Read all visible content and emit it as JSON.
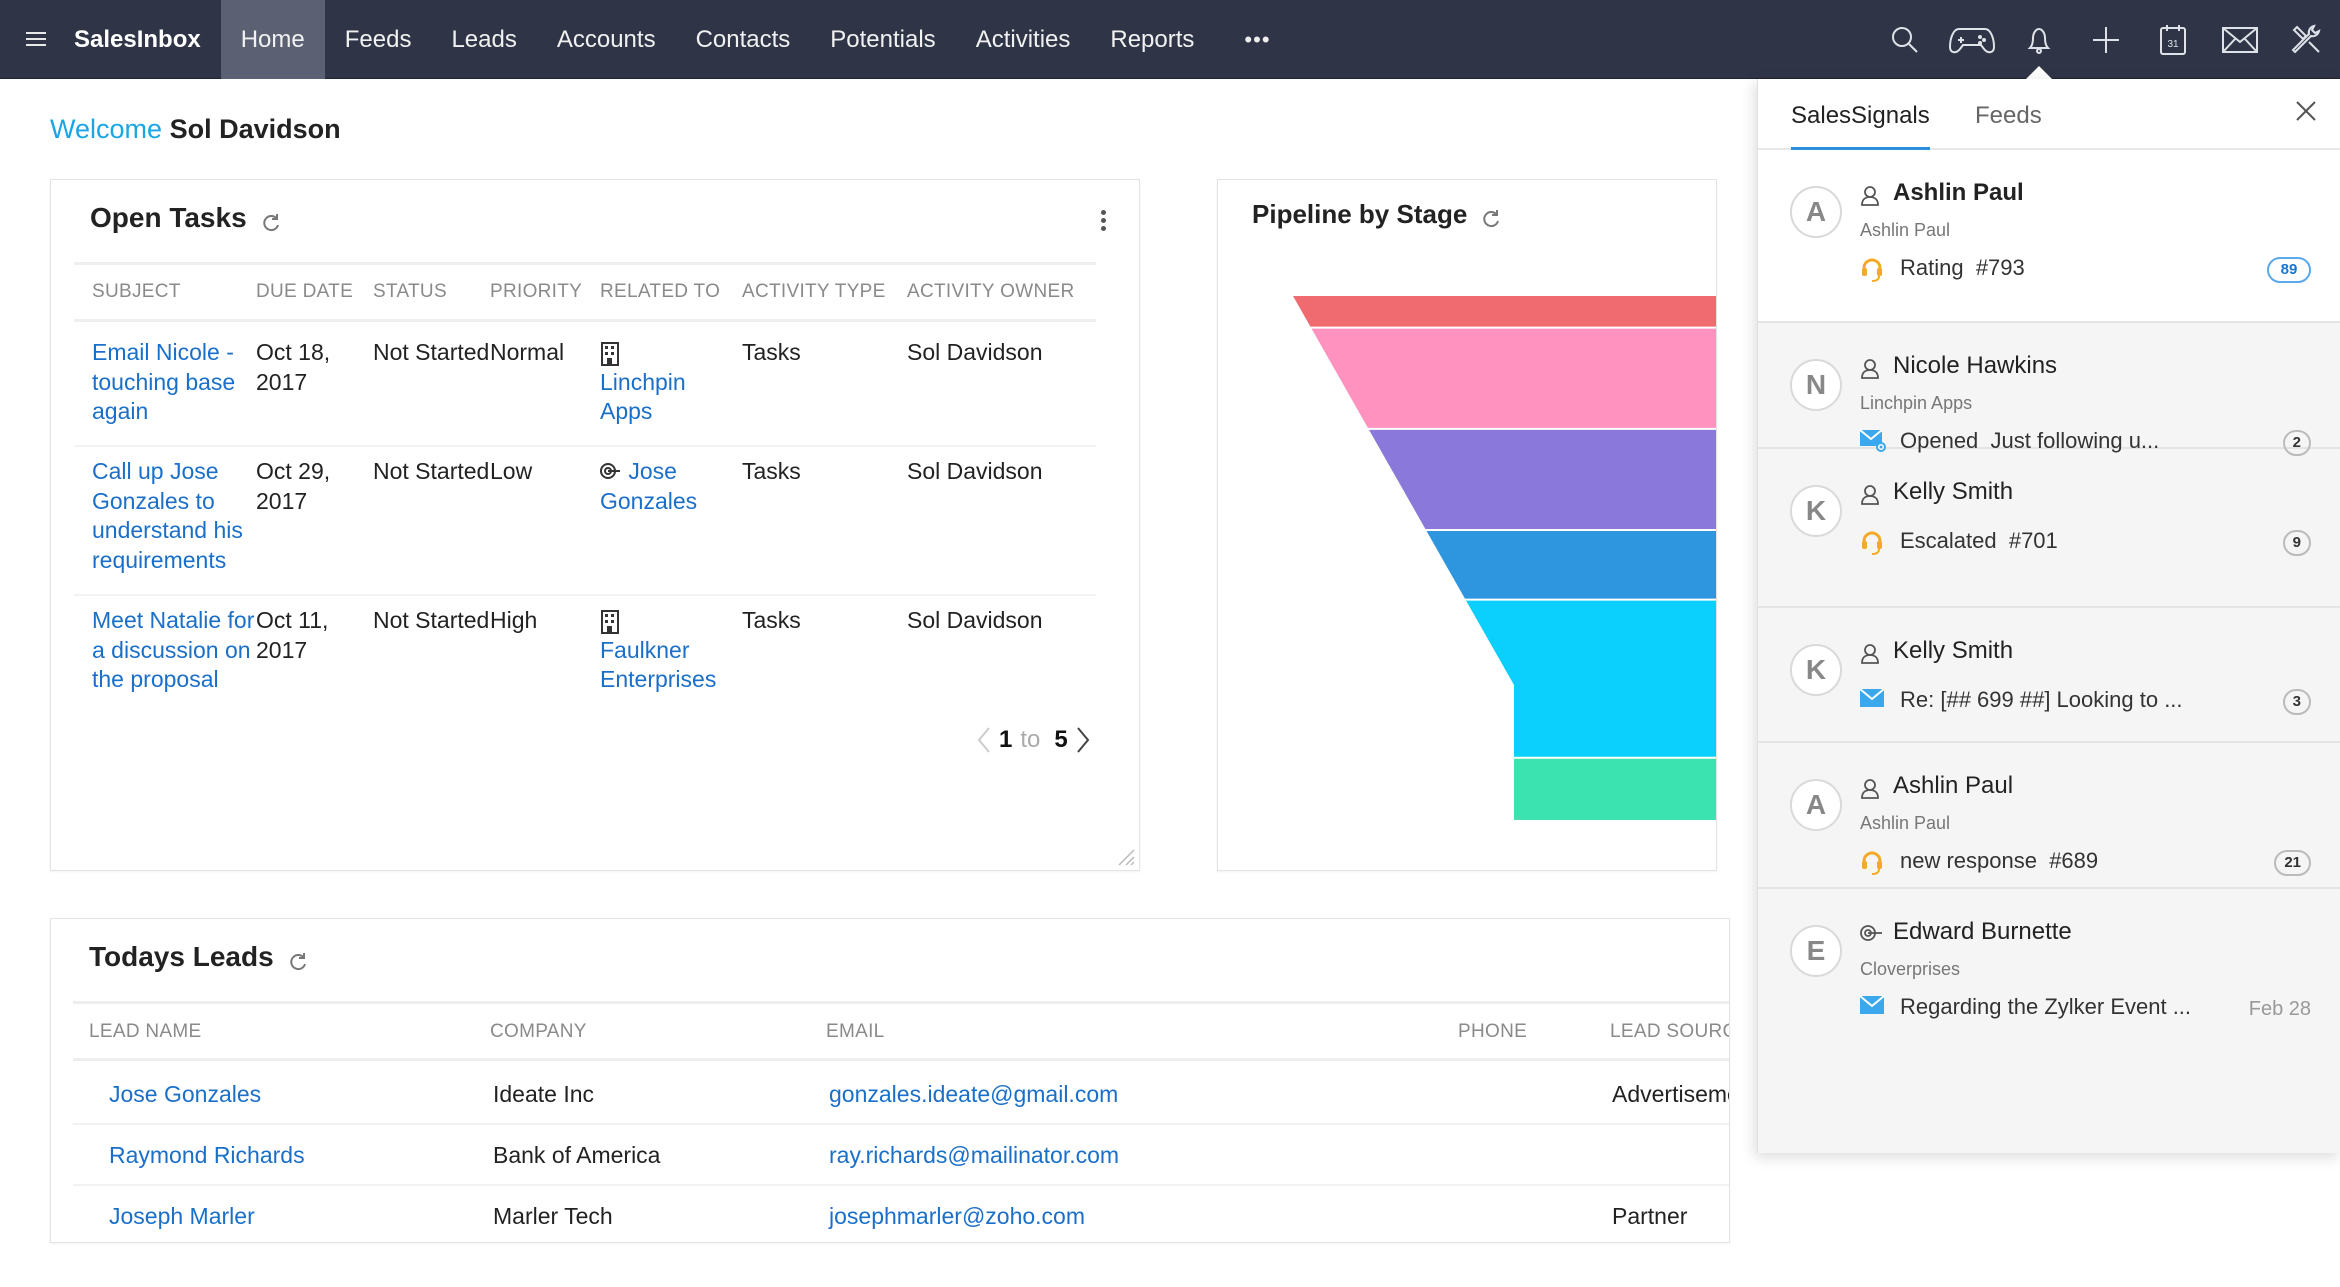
{
  "nav": {
    "brand": "SalesInbox",
    "tabs": [
      "Home",
      "Feeds",
      "Leads",
      "Accounts",
      "Contacts",
      "Potentials",
      "Activities",
      "Reports"
    ],
    "active_tab": "Home",
    "more": "•••",
    "icons": [
      "search-icon",
      "gamepad-icon",
      "bell-icon",
      "plus-icon",
      "calendar-icon",
      "mail-icon",
      "tools-icon"
    ],
    "calendar_day": "31"
  },
  "welcome": {
    "prefix": "Welcome",
    "name": "Sol Davidson"
  },
  "open_tasks": {
    "title": "Open Tasks",
    "columns": [
      "SUBJECT",
      "DUE DATE",
      "STATUS",
      "PRIORITY",
      "RELATED TO",
      "ACTIVITY TYPE",
      "ACTIVITY OWNER"
    ],
    "rows": [
      {
        "subject": "Email Nicole - touching base again",
        "due": "Oct 18, 2017",
        "status": "Not Started",
        "priority": "Normal",
        "related_icon": "building-icon",
        "related": "Linchpin Apps",
        "type": "Tasks",
        "owner": "Sol Davidson"
      },
      {
        "subject": "Call up Jose Gonzales to understand his requirements",
        "due": "Oct 29, 2017",
        "status": "Not Started",
        "priority": "Low",
        "related_icon": "contact-target-icon",
        "related": "Jose Gonzales",
        "type": "Tasks",
        "owner": "Sol Davidson"
      },
      {
        "subject": "Meet Natalie for a discussion on the proposal",
        "due": "Oct 11, 2017",
        "status": "Not Started",
        "priority": "High",
        "related_icon": "building-icon",
        "related": "Faulkner Enterprises",
        "type": "Tasks",
        "owner": "Sol Davidson"
      }
    ],
    "pager": {
      "from": "1",
      "to_label": "to",
      "to": "5"
    }
  },
  "pipeline": {
    "title": "Pipeline by Stage"
  },
  "chart_data": {
    "type": "funnel",
    "title": "Pipeline by Stage",
    "stages": [
      {
        "color": "#f06b70",
        "share": 0.05
      },
      {
        "color": "#ff92be",
        "share": 0.16
      },
      {
        "color": "#8b78db",
        "share": 0.16
      },
      {
        "color": "#2e96de",
        "share": 0.11
      },
      {
        "color": "#0bcffd",
        "share": 0.25
      },
      {
        "color": "#3be3b0",
        "share": 0.1
      }
    ],
    "legend": "none",
    "note": "Stage labels and values not visible (chart cropped on the right)."
  },
  "leads": {
    "title": "Todays Leads",
    "columns": [
      "LEAD NAME",
      "COMPANY",
      "EMAIL",
      "PHONE",
      "LEAD SOURCE"
    ],
    "rows": [
      {
        "name": "Jose Gonzales",
        "company": "Ideate Inc",
        "email": "gonzales.ideate@gmail.com",
        "phone": "",
        "source": "Advertisement"
      },
      {
        "name": "Raymond Richards",
        "company": "Bank of America",
        "email": "ray.richards@mailinator.com",
        "phone": "",
        "source": ""
      },
      {
        "name": "Joseph Marler",
        "company": "Marler Tech",
        "email": "josephmarler@zoho.com",
        "phone": "",
        "source": "Partner"
      }
    ]
  },
  "side_panel": {
    "tabs": [
      "SalesSignals",
      "Feeds"
    ],
    "active_tab": "SalesSignals",
    "items": [
      {
        "initial": "A",
        "type_icon": "person-icon",
        "name": "Ashlin Paul",
        "sub": "Ashlin Paul",
        "act_icon": "headset-icon",
        "action": "Rating  #793",
        "badge": "89",
        "badge_style": "blue",
        "date": ""
      },
      {
        "initial": "N",
        "type_icon": "person-icon",
        "name": "Nicole Hawkins",
        "sub": "Linchpin Apps",
        "act_icon": "mail-opened-icon",
        "action": "Opened  Just following u...",
        "badge": "2",
        "badge_style": "grey",
        "date": ""
      },
      {
        "initial": "K",
        "type_icon": "person-icon",
        "name": "Kelly Smith",
        "sub": "",
        "act_icon": "headset-icon",
        "action": "Escalated  #701",
        "badge": "9",
        "badge_style": "grey",
        "date": ""
      },
      {
        "initial": "K",
        "type_icon": "person-icon",
        "name": "Kelly Smith",
        "sub": "",
        "act_icon": "mail-icon",
        "action": "Re: [## 699 ##] Looking to ...",
        "badge": "3",
        "badge_style": "grey",
        "date": ""
      },
      {
        "initial": "A",
        "type_icon": "person-icon",
        "name": "Ashlin Paul",
        "sub": "Ashlin Paul",
        "act_icon": "headset-icon",
        "action": "new response  #689",
        "badge": "21",
        "badge_style": "grey",
        "date": ""
      },
      {
        "initial": "E",
        "type_icon": "contact-target-icon",
        "name": "Edward Burnette",
        "sub": "Cloverprises",
        "act_icon": "mail-icon",
        "action": "Regarding the Zylker Event ...",
        "badge": "",
        "badge_style": "",
        "date": "Feb 28"
      }
    ]
  }
}
